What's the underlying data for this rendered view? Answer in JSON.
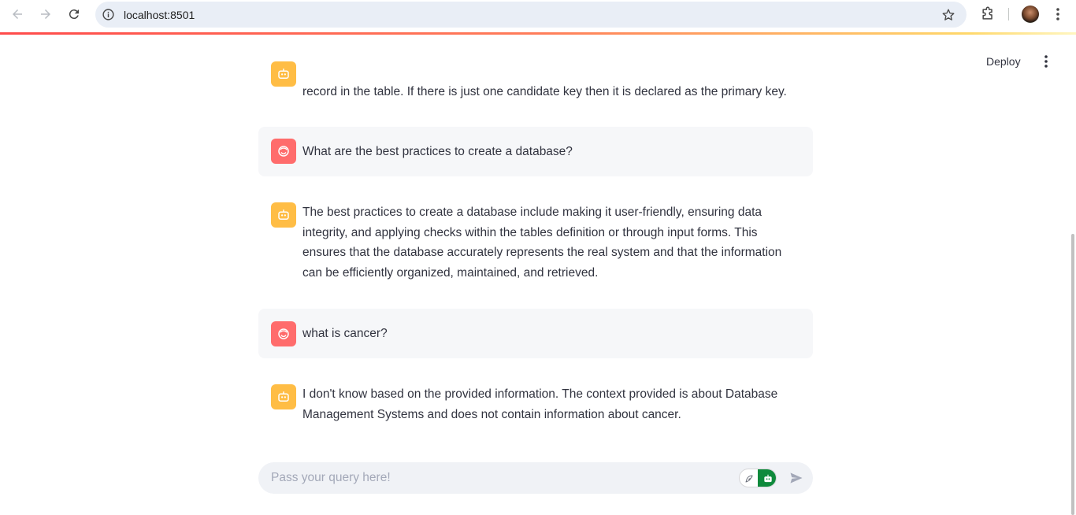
{
  "browser": {
    "url": "localhost:8501"
  },
  "header": {
    "deploy_label": "Deploy"
  },
  "messages": [
    {
      "role": "assistant",
      "text": "record in the table. If there is just one candidate key then it is declared as the primary key."
    },
    {
      "role": "user",
      "text": "What are the best practices to create a database?"
    },
    {
      "role": "assistant",
      "text": "The best practices to create a database include making it user-friendly, ensuring data integrity, and applying checks within the tables definition or through input forms. This ensures that the database accurately represents the real system and that the information can be efficiently organized, maintained, and retrieved."
    },
    {
      "role": "user",
      "text": "what is cancer?"
    },
    {
      "role": "assistant",
      "text": "I don't know based on the provided information. The context provided is about Database Management Systems and does not contain information about cancer."
    }
  ],
  "chat_input": {
    "placeholder": "Pass your query here!",
    "value": ""
  },
  "colors": {
    "user_avatar": "#ff6c6c",
    "assistant_avatar": "#ffbd45",
    "user_bubble": "#f6f7f9",
    "input_bg": "#f0f2f6",
    "toggle_active": "#0f8a3c"
  },
  "icons": {
    "user_avatar": "user-face-icon",
    "assistant_avatar": "robot-icon",
    "send": "send-icon",
    "toggle_left": "feather-icon",
    "toggle_right": "robot-icon"
  }
}
